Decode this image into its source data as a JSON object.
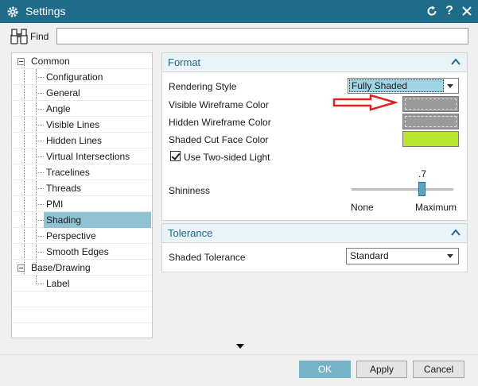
{
  "window": {
    "title": "Settings",
    "help_label": "?"
  },
  "find": {
    "label": "Find",
    "value": ""
  },
  "tree": {
    "items": [
      {
        "label": "Common"
      },
      {
        "label": "Configuration"
      },
      {
        "label": "General"
      },
      {
        "label": "Angle"
      },
      {
        "label": "Visible Lines"
      },
      {
        "label": "Hidden Lines"
      },
      {
        "label": "Virtual Intersections"
      },
      {
        "label": "Tracelines"
      },
      {
        "label": "Threads"
      },
      {
        "label": "PMI"
      },
      {
        "label": "Shading",
        "selected": true
      },
      {
        "label": "Perspective"
      },
      {
        "label": "Smooth Edges"
      },
      {
        "label": "Base/Drawing"
      },
      {
        "label": "Label"
      }
    ]
  },
  "format": {
    "title": "Format",
    "rendering_style": {
      "label": "Rendering Style",
      "value": "Fully Shaded"
    },
    "visible_wireframe_color": {
      "label": "Visible Wireframe Color",
      "color": "#9a9a9a"
    },
    "hidden_wireframe_color": {
      "label": "Hidden Wireframe Color",
      "color": "#9a9a9a"
    },
    "shaded_cut_face_color": {
      "label": "Shaded Cut Face Color",
      "color": "#b8e830"
    },
    "two_sided_light": {
      "label": "Use Two-sided Light",
      "checked": true
    },
    "shininess": {
      "label": "Shininess",
      "value_label": ".7",
      "value": 0.7,
      "min_label": "None",
      "max_label": "Maximum"
    }
  },
  "tolerance": {
    "title": "Tolerance",
    "shaded_tolerance": {
      "label": "Shaded Tolerance",
      "value": "Standard"
    }
  },
  "buttons": {
    "ok": "OK",
    "apply": "Apply",
    "cancel": "Cancel"
  },
  "colors": {
    "titlebar": "#1e6b8a",
    "accent": "#1e6b8a",
    "selection": "#8fc3d3",
    "ok_button": "#76b3c7",
    "annotation_arrow": "#e02020"
  },
  "icons": {
    "window": "gear-icon",
    "refresh": "refresh-icon",
    "help": "help-icon",
    "close": "close-icon",
    "find": "binoculars-icon",
    "collapse": "chevron-up-icon",
    "annotation": "red-arrow-icon"
  }
}
